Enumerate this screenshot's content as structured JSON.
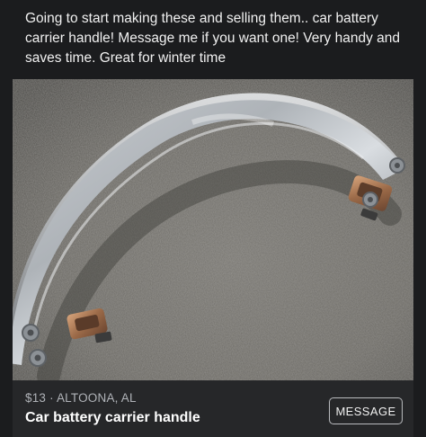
{
  "post": {
    "text": "Going to start making these and selling them..  car battery carrier handle!  Message me if you want one!  Very handy and saves time.   Great for winter time"
  },
  "listing": {
    "price_location": "$13 · ALTOONA, AL",
    "title": "Car battery carrier handle",
    "message_button_label": "MESSAGE"
  },
  "colors": {
    "background": "#1b1c1e",
    "listing_bar": "#262729",
    "button_border": "#b9bbbe"
  }
}
